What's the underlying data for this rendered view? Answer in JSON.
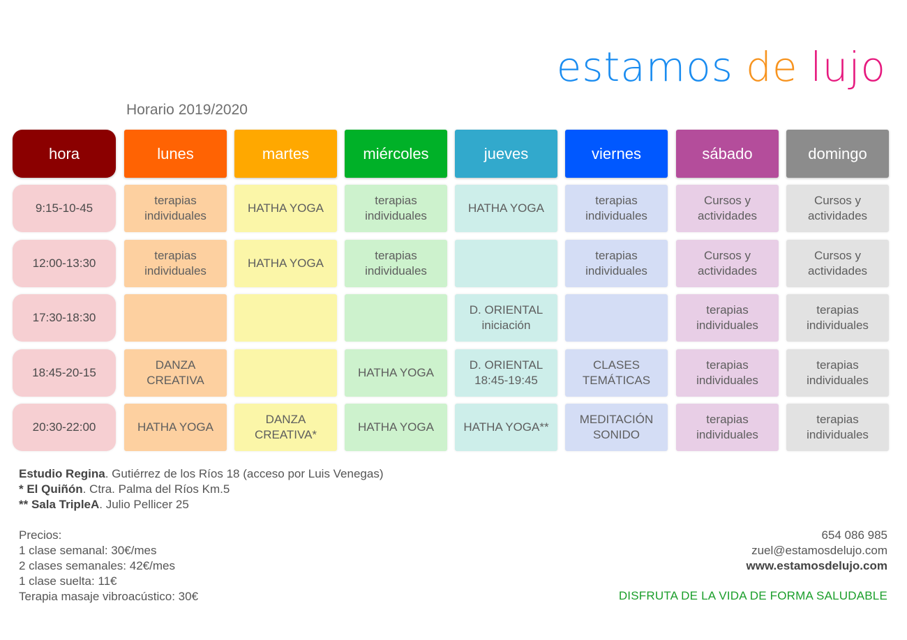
{
  "logo": {
    "w1": "estamos",
    "w2": "de",
    "w3": "lujo"
  },
  "title": "Horario 2019/2020",
  "colors": {
    "hora": "#8b0000",
    "lunes": "#ff6303",
    "martes": "#ffa800",
    "miercoles": "#00b128",
    "jueves": "#32a9cc",
    "viernes": "#0058ff",
    "sabado": "#b44d9b",
    "domingo": "#8c8c8c",
    "hora_light": "#f6cfd2",
    "lunes_light": "#fdd0a0",
    "martes_light": "#fbf6a8",
    "miercoles_light": "#cdf2cd",
    "jueves_light": "#cdeeea",
    "viernes_light": "#d4ddf5",
    "sabado_light": "#e8cee6",
    "domingo_light": "#e2e2e2",
    "slogan": "#1a9e2a"
  },
  "schedule": {
    "headers": [
      "hora",
      "lunes",
      "martes",
      "miércoles",
      "jueves",
      "viernes",
      "sábado",
      "domingo"
    ],
    "rows": [
      {
        "time": "9:15-10-45",
        "cells": [
          "terapias\nindividuales",
          "HATHA YOGA",
          "terapias\nindividuales",
          "HATHA YOGA",
          "terapias\nindividuales",
          "Cursos y\nactividades",
          "Cursos y\nactividades"
        ]
      },
      {
        "time": "12:00-13:30",
        "cells": [
          "terapias\nindividuales",
          "HATHA YOGA",
          "terapias\nindividuales",
          "",
          "terapias\nindividuales",
          "Cursos y\nactividades",
          "Cursos y\nactividades"
        ]
      },
      {
        "time": "17:30-18:30",
        "cells": [
          "",
          "",
          "",
          "D. ORIENTAL\niniciación",
          "",
          "terapias\nindividuales",
          "terapias\nindividuales"
        ]
      },
      {
        "time": "18:45-20-15",
        "cells": [
          "DANZA\nCREATIVA",
          "",
          "HATHA YOGA",
          "D. ORIENTAL\n18:45-19:45",
          "CLASES\nTEMÁTICAS",
          "terapias\nindividuales",
          "terapias\nindividuales"
        ]
      },
      {
        "time": "20:30-22:00",
        "cells": [
          "HATHA YOGA",
          "DANZA\nCREATIVA*",
          "HATHA YOGA",
          "HATHA YOGA**",
          "MEDITACIÓN\nSONIDO",
          "terapias\nindividuales",
          "terapias\nindividuales"
        ]
      }
    ]
  },
  "locations": {
    "l1_name": "Estudio Regina",
    "l1_rest": ". Gutiérrez de los Ríos 18 (acceso por Luis Venegas)",
    "l2_name": "* El Quiñón",
    "l2_rest": ". Ctra. Palma del Ríos Km.5",
    "l3_name": "** Sala TripleA",
    "l3_rest": ". Julio Pellicer 25"
  },
  "prices": {
    "heading": "Precios:",
    "items": [
      "1 clase semanal: 30€/mes",
      "2 clases semanales: 42€/mes",
      "1 clase suelta: 11€",
      "Terapia masaje vibroacústico: 30€"
    ]
  },
  "contact": {
    "phone": "654 086 985",
    "email": "zuel@estamosdelujo.com",
    "web": "www.estamosdelujo.com"
  },
  "slogan": "DISFRUTA DE LA VIDA DE FORMA SALUDABLE"
}
